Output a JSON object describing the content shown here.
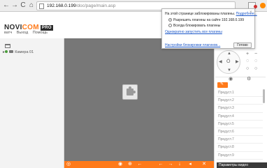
{
  "browser": {
    "back_label": "←",
    "forward_label": "→",
    "reload_label": "C",
    "home_label": "⌂",
    "url_host": "192.168.0.199",
    "url_path": "/doc/page/main.asp",
    "close_label": "×"
  },
  "header": {
    "logo_text": "NOVI",
    "logo_accent": "COM",
    "logo_badge": "PRO",
    "links": [
      "ватч",
      "Выход",
      "Помощь"
    ]
  },
  "device_tree": {
    "item_label": "Камера 01"
  },
  "popup": {
    "message": "На этой странице заблокированы плагины.",
    "more_link": "Подробнее...",
    "option_allow": "Разрешить плагины на сайте 192.168.0.199",
    "option_block": "Всегда блокировать плагины",
    "run_once_link": "Однократно запустить все плагины",
    "settings_link": "Настройки блокировки плагинов...",
    "done_button": "Готово",
    "close_symbol": "×"
  },
  "ptz": {
    "up": "▲",
    "down": "▼",
    "left": "◀",
    "right": "▶",
    "center": "Ö",
    "zoom_in": "+",
    "zoom_out": "−"
  },
  "presets": {
    "items": [
      "Предуст.1",
      "Предуст.2",
      "Предуст.3",
      "Предуст.4",
      "Предуст.5",
      "Предуст.6",
      "Предуст.7",
      "Предуст.8",
      "Предуст.9"
    ],
    "action_label": "✎",
    "params_label": "Параметры видео"
  },
  "bottombar": {
    "icons": [
      "camera-icon",
      "record-icon",
      "zoom-icon",
      "back-icon",
      "prev-icon",
      "next-icon",
      "download-icon",
      "volume-icon",
      "fullscreen-icon"
    ],
    "icon_glyphs": [
      "◎",
      "◉",
      "⊕",
      "←",
      "←",
      "→",
      "↓",
      "◂",
      "✕"
    ]
  },
  "colors": {
    "accent": "#ff7a1a",
    "video_bg": "#777777",
    "link": "#1a56c8"
  }
}
